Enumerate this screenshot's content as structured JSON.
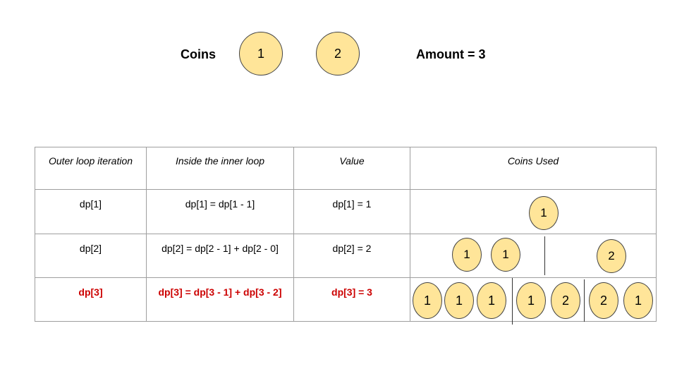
{
  "header": {
    "coins_label": "Coins",
    "coins": [
      "1",
      "2"
    ],
    "amount_label": "Amount = 3"
  },
  "table": {
    "columns": [
      "Outer loop iteration",
      "Inside the inner loop",
      "Value",
      "Coins Used"
    ],
    "rows": [
      {
        "iteration": "dp[1]",
        "inner": "dp[1] = dp[1 - 1]",
        "value": "dp[1] = 1",
        "coins": [
          "1"
        ]
      },
      {
        "iteration": "dp[2]",
        "inner": "dp[2] = dp[2 - 1] + dp[2 - 0]",
        "value": "dp[2] = 2",
        "coins": [
          "1",
          "1",
          "2"
        ]
      },
      {
        "iteration": "dp[3]",
        "inner": "dp[3] = dp[3 - 1] + dp[3 - 2]",
        "value": "dp[3] = 3",
        "coins": [
          "1",
          "1",
          "1",
          "1",
          "2",
          "2",
          "1"
        ]
      }
    ],
    "highlight_color": "#cc0000"
  },
  "colors": {
    "coin_fill": "#ffe599",
    "grid_line": "#9e9e9e"
  }
}
